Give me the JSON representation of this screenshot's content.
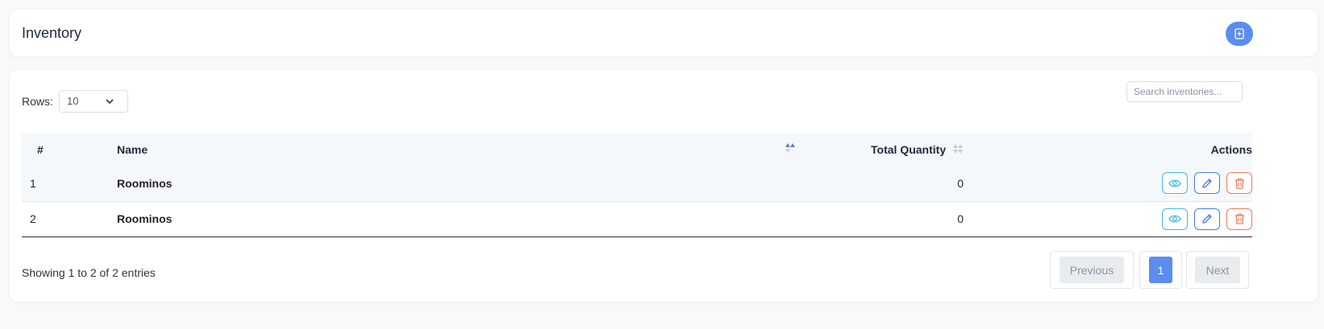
{
  "header": {
    "title": "Inventory",
    "add_icon": "add-document-icon"
  },
  "controls": {
    "rows_label": "Rows:",
    "rows_value": "10",
    "search_placeholder": "Search inventories..."
  },
  "table": {
    "columns": {
      "num": "#",
      "name": "Name",
      "total_quantity": "Total Quantity",
      "actions": "Actions"
    },
    "rows": [
      {
        "num": "1",
        "name": "Roominos",
        "total_quantity": "0"
      },
      {
        "num": "2",
        "name": "Roominos",
        "total_quantity": "0"
      }
    ],
    "action_icons": [
      "eye-icon",
      "pencil-icon",
      "trash-icon"
    ]
  },
  "footer": {
    "entries_info": "Showing 1 to 2 of 2 entries",
    "prev_label": "Previous",
    "page_label": "1",
    "next_label": "Next"
  },
  "colors": {
    "accent": "#5b8def",
    "view": "#3fb8e8",
    "edit": "#4a78e8",
    "delete": "#ef7a5a",
    "table_header_bg": "#f5f8fb"
  }
}
